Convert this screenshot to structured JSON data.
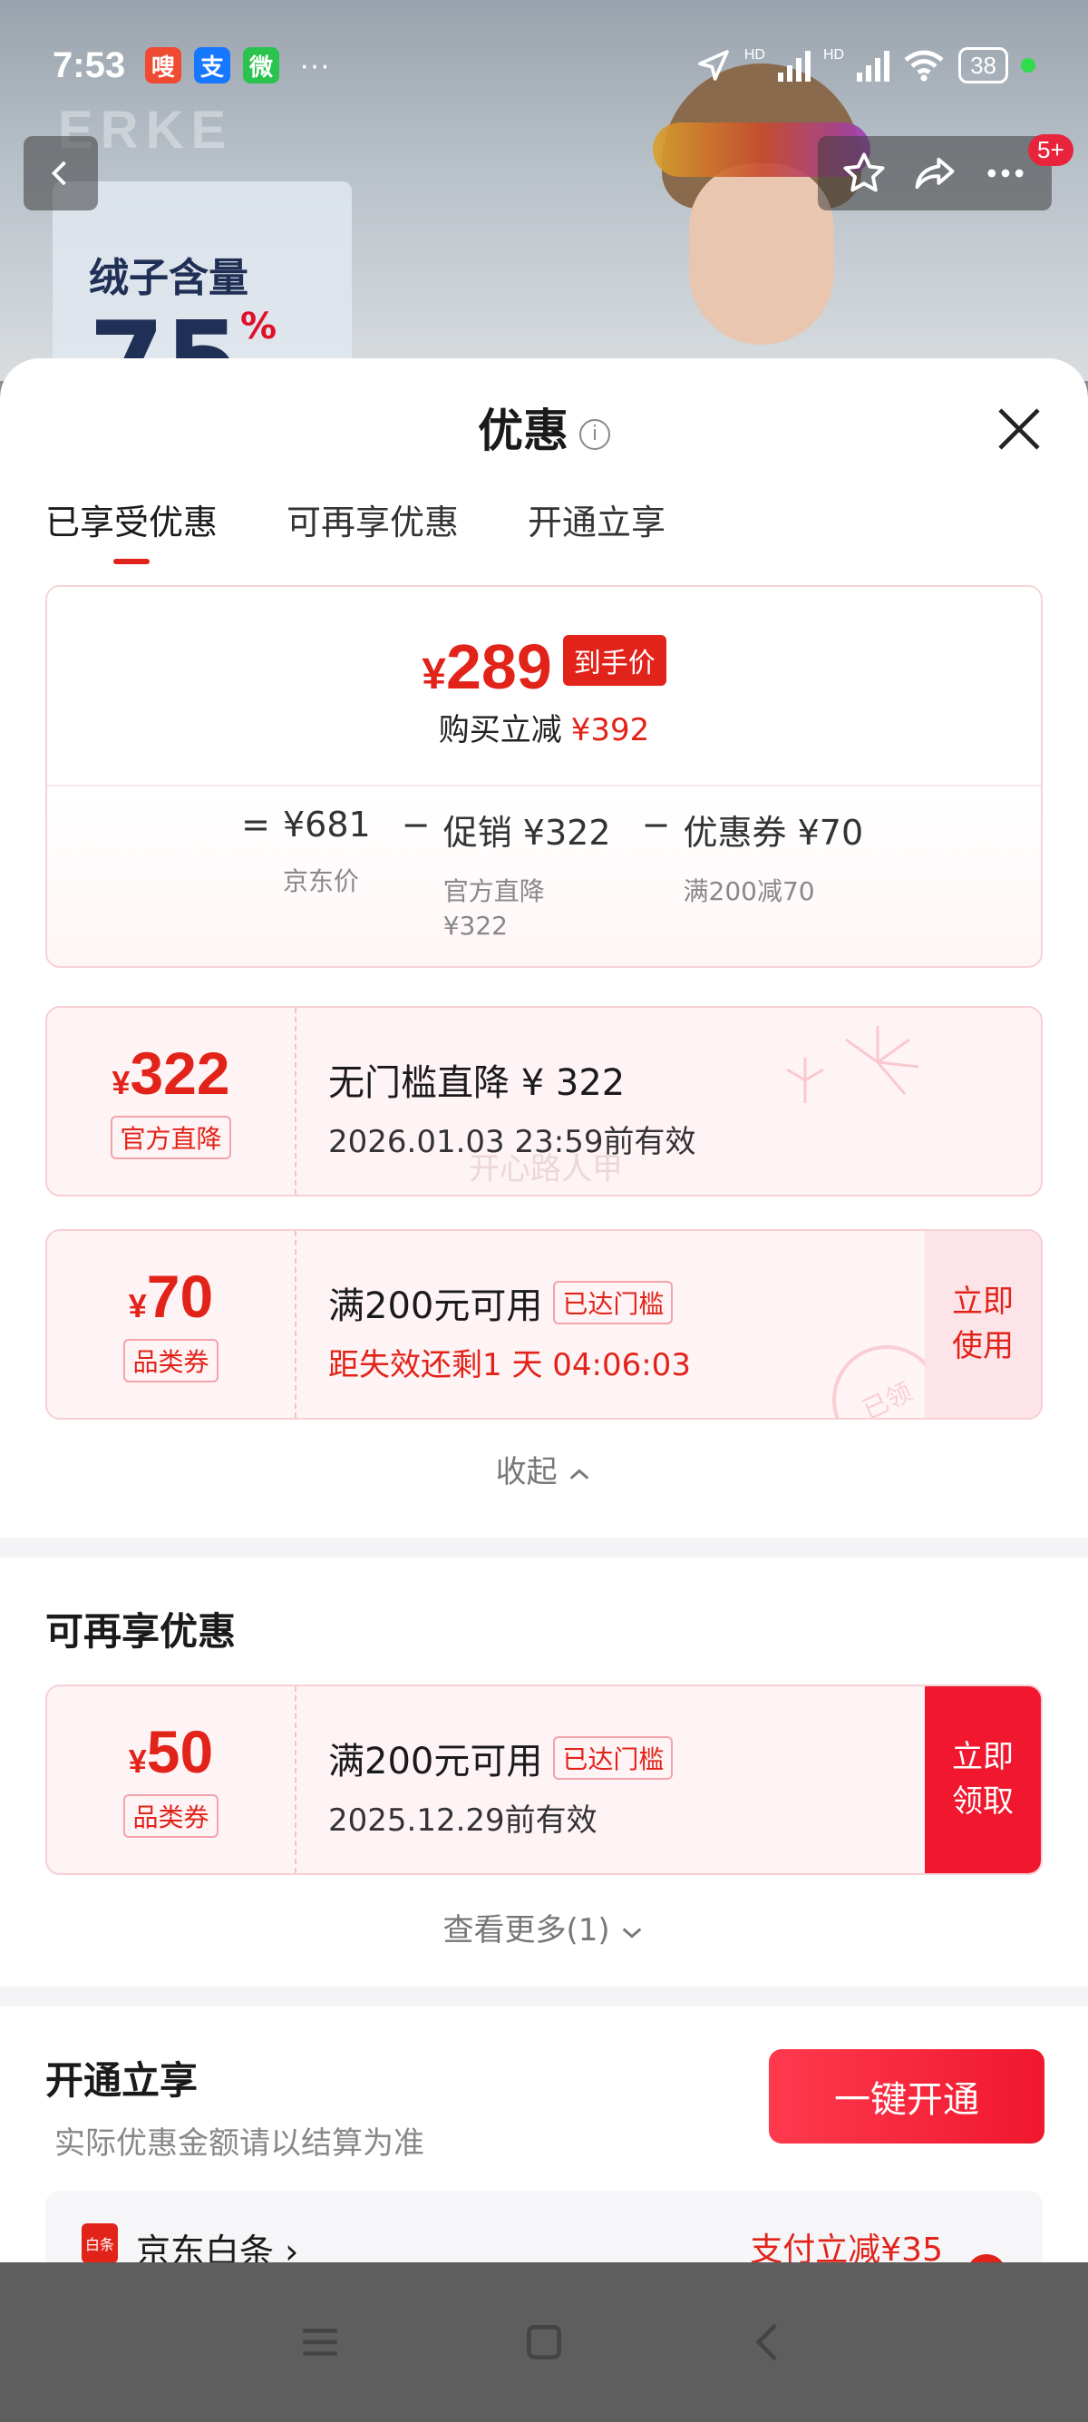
{
  "status_bar": {
    "time": "7:53",
    "app_icons": [
      {
        "icon": "app-red-icon",
        "glyph": "嗖",
        "color": "#f04a33"
      },
      {
        "icon": "alipay-icon",
        "glyph": "支",
        "color": "#1677ff"
      },
      {
        "icon": "wechat-icon",
        "glyph": "微",
        "color": "#2ac34e"
      }
    ],
    "more": "···",
    "hd1": "HD",
    "hd2": "HD",
    "battery": "38"
  },
  "background": {
    "brand": "ERKE",
    "promo_line1": "绒子含量",
    "promo_value": "75",
    "promo_unit": "%"
  },
  "header_actions": {
    "badge": "5+"
  },
  "sheet": {
    "title": "优惠",
    "info_glyph": "i",
    "tabs": [
      {
        "label": "已享受优惠"
      },
      {
        "label": "可再享优惠"
      },
      {
        "label": "开通立享"
      }
    ]
  },
  "summary": {
    "currency": "¥",
    "final_price": "289",
    "final_tag": "到手价",
    "saved_label": "购买立减",
    "saved_value": "¥392",
    "eq": "=",
    "minus": "−",
    "terms": [
      {
        "value": "¥681",
        "sub": "京东价"
      },
      {
        "value": "促销 ¥322",
        "sub": "官方直降 ¥322"
      },
      {
        "value": "优惠券 ¥70",
        "sub": "满200减70"
      }
    ]
  },
  "coupons": [
    {
      "currency": "¥",
      "amount": "322",
      "tag": "官方直降",
      "title": "无门槛直降 ¥ 322",
      "detail": "2026.01.03 23:59前有效",
      "watermark": "开心路人甲"
    },
    {
      "currency": "¥",
      "amount": "70",
      "tag": "品类券",
      "title": "满200元可用",
      "chip": "已达门槛",
      "detail": "距失效还剩1 天 04:06:03",
      "action": "立即\n使用",
      "stamp": "已领"
    }
  ],
  "collapse_label": "收起",
  "more_offers": {
    "title": "可再享优惠",
    "coupon": {
      "currency": "¥",
      "amount": "50",
      "tag": "品类券",
      "title": "满200元可用",
      "chip": "已达门槛",
      "detail": "2025.12.29前有效",
      "action": "立即\n领取"
    },
    "see_more": "查看更多(1)"
  },
  "open_section": {
    "title": "开通立享",
    "subtitle": "实际优惠金额请以结算为准",
    "button": "一键开通",
    "baitiao_icon": "白条",
    "baitiao_name": "京东白条",
    "baitiao_offer": "支付立减¥35"
  },
  "colors": {
    "accent_red": "#e2231a",
    "button_red": "#f0172e",
    "coupon_bg": "#fff4f5"
  }
}
